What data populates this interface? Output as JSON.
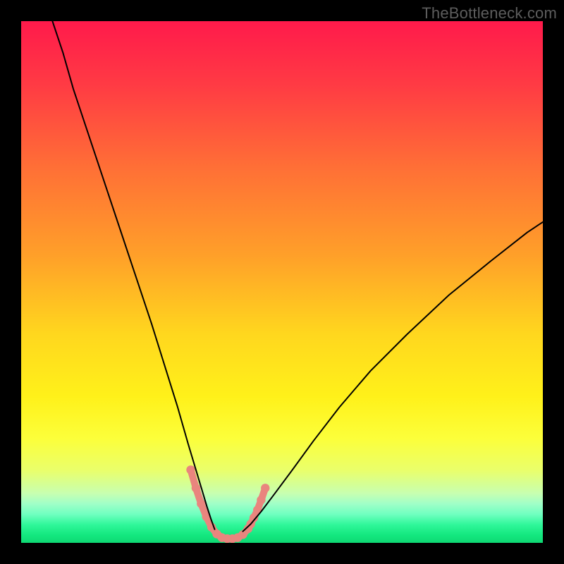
{
  "watermark": {
    "text": "TheBottleneck.com"
  },
  "chart_data": {
    "type": "line",
    "title": "",
    "xlabel": "",
    "ylabel": "",
    "xlim": [
      0,
      100
    ],
    "ylim": [
      0,
      100
    ],
    "grid": false,
    "legend": false,
    "background_gradient": {
      "stops": [
        {
          "position": 0.0,
          "color": "#ff1a4b"
        },
        {
          "position": 0.12,
          "color": "#ff3a44"
        },
        {
          "position": 0.28,
          "color": "#ff6f36"
        },
        {
          "position": 0.45,
          "color": "#ffa029"
        },
        {
          "position": 0.6,
          "color": "#ffd71e"
        },
        {
          "position": 0.72,
          "color": "#fff11a"
        },
        {
          "position": 0.8,
          "color": "#fcff3a"
        },
        {
          "position": 0.86,
          "color": "#eaff6a"
        },
        {
          "position": 0.905,
          "color": "#c8ffb0"
        },
        {
          "position": 0.925,
          "color": "#a0ffc8"
        },
        {
          "position": 0.945,
          "color": "#70ffc0"
        },
        {
          "position": 0.965,
          "color": "#30f79a"
        },
        {
          "position": 0.985,
          "color": "#13e87f"
        },
        {
          "position": 1.0,
          "color": "#0fd873"
        }
      ]
    },
    "series": [
      {
        "name": "left-curve",
        "stroke": "#000000",
        "stroke_width": 2,
        "x": [
          6.0,
          8.0,
          10.0,
          13.0,
          16.0,
          19.0,
          22.0,
          25.0,
          27.5,
          30.0,
          32.0,
          33.5,
          34.7,
          35.6,
          36.4,
          37.1
        ],
        "y": [
          100.0,
          94.0,
          87.0,
          78.0,
          69.0,
          60.0,
          51.0,
          42.0,
          34.0,
          26.0,
          19.0,
          14.0,
          10.0,
          7.0,
          4.5,
          2.6
        ]
      },
      {
        "name": "trough-band",
        "stroke": "#e9857e",
        "stroke_width": 10,
        "x": [
          32.5,
          33.5,
          34.5,
          35.5,
          36.5,
          37.5,
          38.5,
          39.5,
          40.5,
          41.5,
          42.5,
          43.5,
          44.0,
          44.6,
          45.3,
          46.0,
          46.8
        ],
        "y": [
          14.0,
          10.5,
          7.5,
          5.0,
          3.0,
          1.7,
          1.0,
          0.8,
          0.8,
          1.0,
          1.6,
          2.7,
          3.6,
          4.8,
          6.3,
          8.2,
          10.5
        ]
      },
      {
        "name": "right-curve",
        "stroke": "#000000",
        "stroke_width": 2,
        "x": [
          42.5,
          44.0,
          46.0,
          48.5,
          52.0,
          56.0,
          61.0,
          67.0,
          74.0,
          82.0,
          90.0,
          97.0,
          100.0
        ],
        "y": [
          2.2,
          3.6,
          6.0,
          9.3,
          14.0,
          19.5,
          26.0,
          33.0,
          40.0,
          47.5,
          54.0,
          59.5,
          61.5
        ]
      }
    ],
    "annotations": []
  }
}
